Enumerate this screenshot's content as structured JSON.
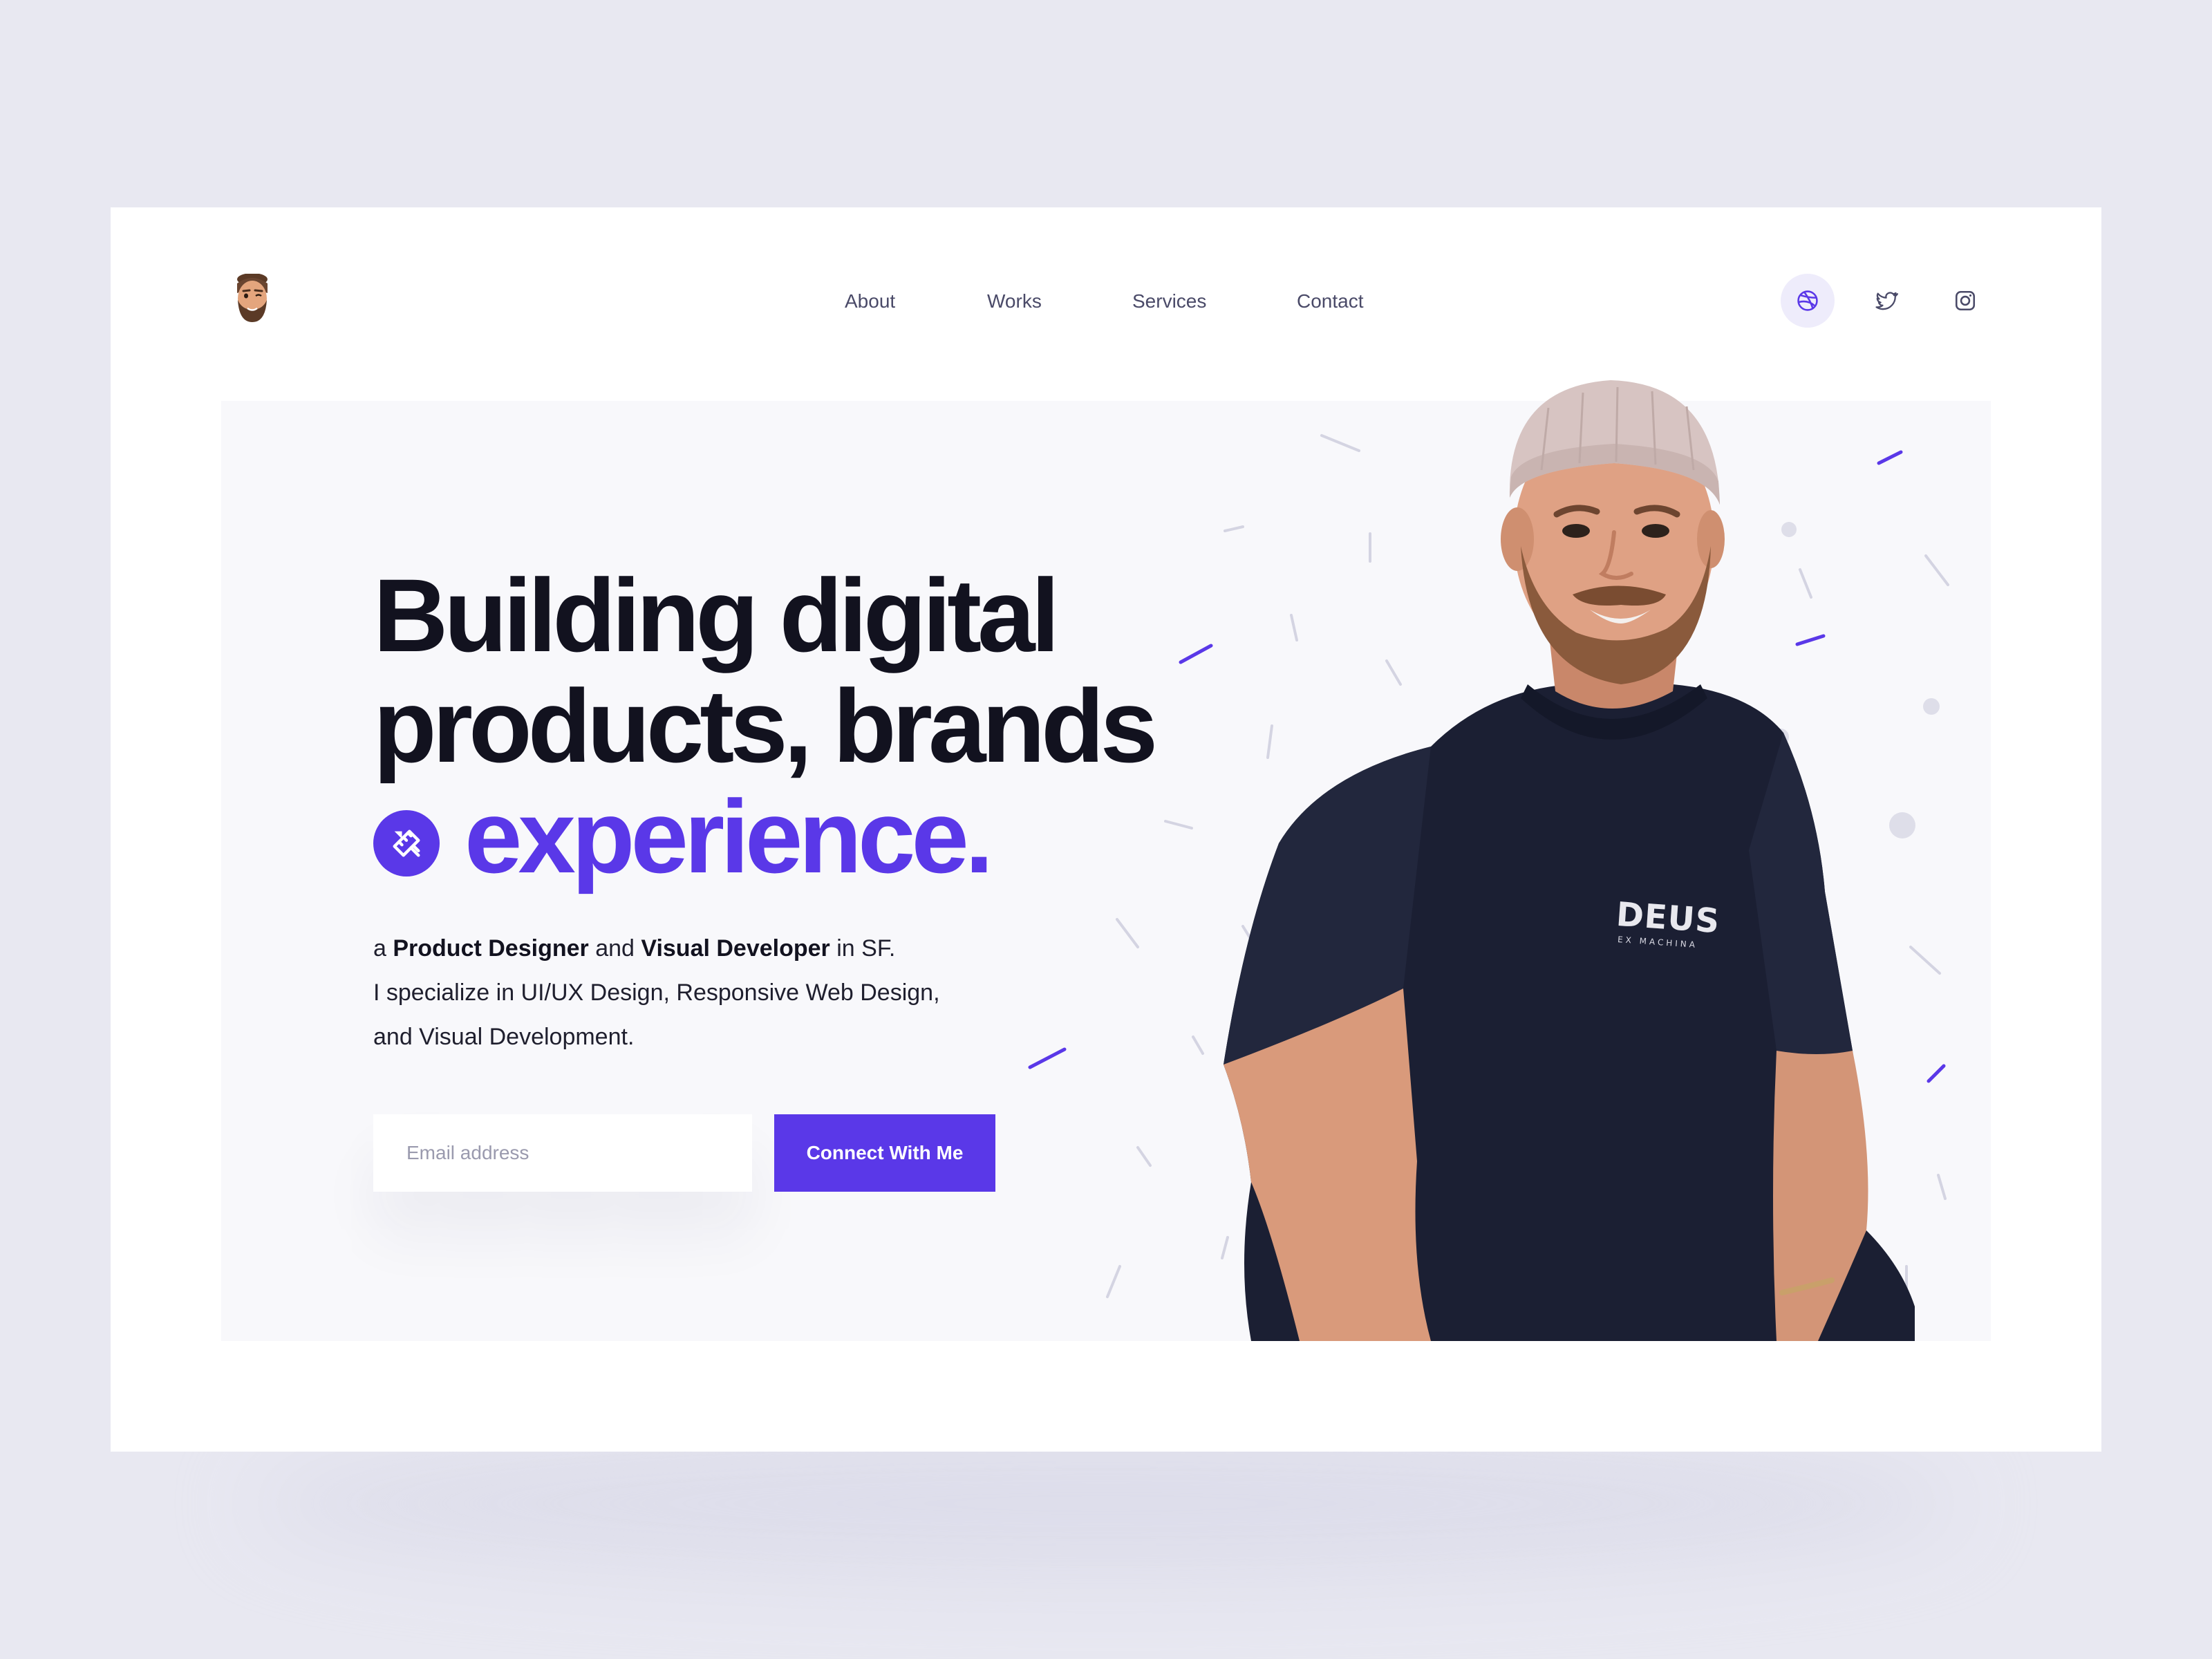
{
  "header": {
    "logo_icon": "memoji-avatar-icon",
    "nav": [
      {
        "label": "About"
      },
      {
        "label": "Works"
      },
      {
        "label": "Services"
      },
      {
        "label": "Contact"
      }
    ],
    "social": [
      {
        "icon": "dribbble-icon",
        "active": true
      },
      {
        "icon": "twitter-icon",
        "active": false
      },
      {
        "icon": "instagram-icon",
        "active": false
      }
    ]
  },
  "hero": {
    "headline": {
      "line1": "Building digital",
      "line2": "products, brands",
      "accent_icon": "pencil-ruler-icon",
      "accent_word": "experience."
    },
    "intro": {
      "prefix": "a ",
      "role1": "Product Designer",
      "joiner": " and ",
      "role2": "Visual Developer",
      "suffix": " in SF.",
      "line2": "I specialize in UI/UX Design, Responsive Web Design,",
      "line3": "and Visual Development."
    },
    "email_placeholder": "Email address",
    "cta_label": "Connect With Me",
    "portrait": {
      "shirt_brand": "DEUS",
      "shirt_sub": "EX MACHINA"
    }
  },
  "colors": {
    "accent": "#5a38e8",
    "headline": "#12121f",
    "page_background": "#e8e8f1",
    "hero_background": "#f8f8fb",
    "nav_text": "#4a4a68"
  }
}
